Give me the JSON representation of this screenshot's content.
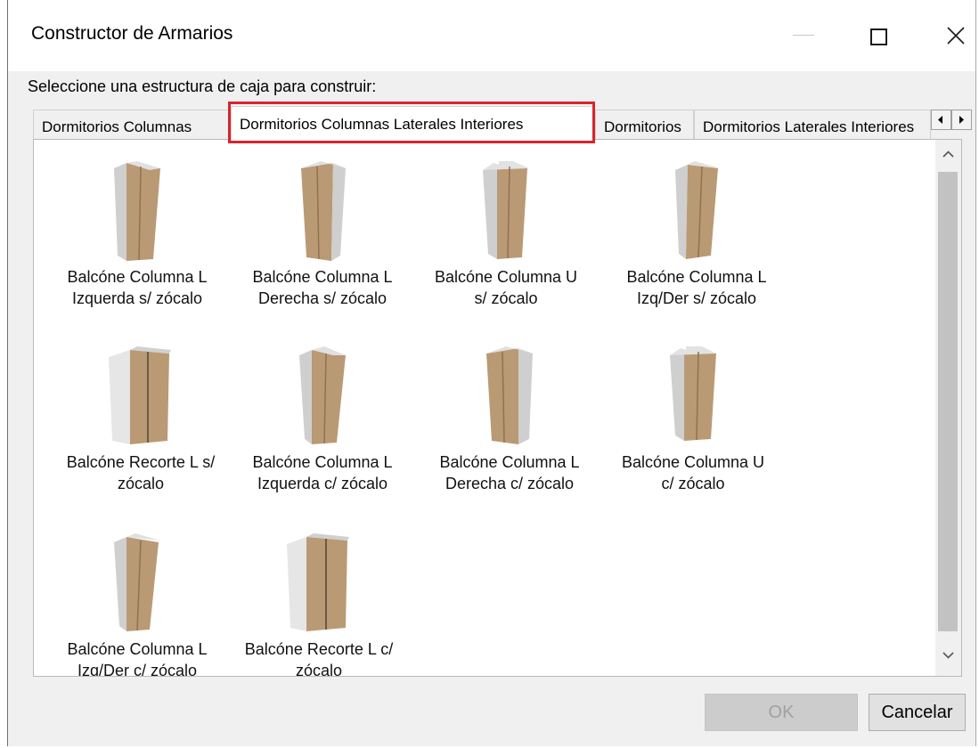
{
  "window": {
    "title": "Constructor de Armarios"
  },
  "prompt": "Seleccione una estructura de caja para construir:",
  "tabs": [
    {
      "label": "Dormitorios Columnas",
      "active": false
    },
    {
      "label": "Dormitorios Columnas Laterales Interiores",
      "active": true
    },
    {
      "label": "Dormitorios",
      "active": false
    },
    {
      "label": "Dormitorios Laterales Interiores",
      "active": false
    }
  ],
  "items": [
    {
      "line1": "Balcóne Columna L",
      "line2": "Izquerda s/ zócalo",
      "icon": "cabinet-l-left-icon"
    },
    {
      "line1": "Balcóne Columna L",
      "line2": "Derecha s/ zócalo",
      "icon": "cabinet-l-right-icon"
    },
    {
      "line1": "Balcóne Columna U",
      "line2": "s/ zócalo",
      "icon": "cabinet-u-icon"
    },
    {
      "line1": "Balcóne Columna L",
      "line2": "Izq/Der s/ zócalo",
      "icon": "cabinet-l-both-icon"
    },
    {
      "line1": "Balcóne Recorte L s/",
      "line2": "zócalo",
      "icon": "cabinet-cut-l-icon"
    },
    {
      "line1": "Balcóne Columna L",
      "line2": "Izquerda c/ zócalo",
      "icon": "cabinet-l-left-icon"
    },
    {
      "line1": "Balcóne Columna L",
      "line2": "Derecha c/ zócalo",
      "icon": "cabinet-l-right-icon"
    },
    {
      "line1": "Balcóne Columna U",
      "line2": "c/ zócalo",
      "icon": "cabinet-u-icon"
    },
    {
      "line1": "Balcóne Columna L",
      "line2": "Izq/Der c/ zócalo",
      "icon": "cabinet-l-both-icon"
    },
    {
      "line1": "Balcóne Recorte L c/",
      "line2": "zócalo",
      "icon": "cabinet-cut-l-icon"
    }
  ],
  "buttons": {
    "ok": "OK",
    "cancel": "Cancelar"
  },
  "colors": {
    "highlight": "#d9242a",
    "wood": "#b99a74",
    "panel": "#d9d9d9"
  }
}
